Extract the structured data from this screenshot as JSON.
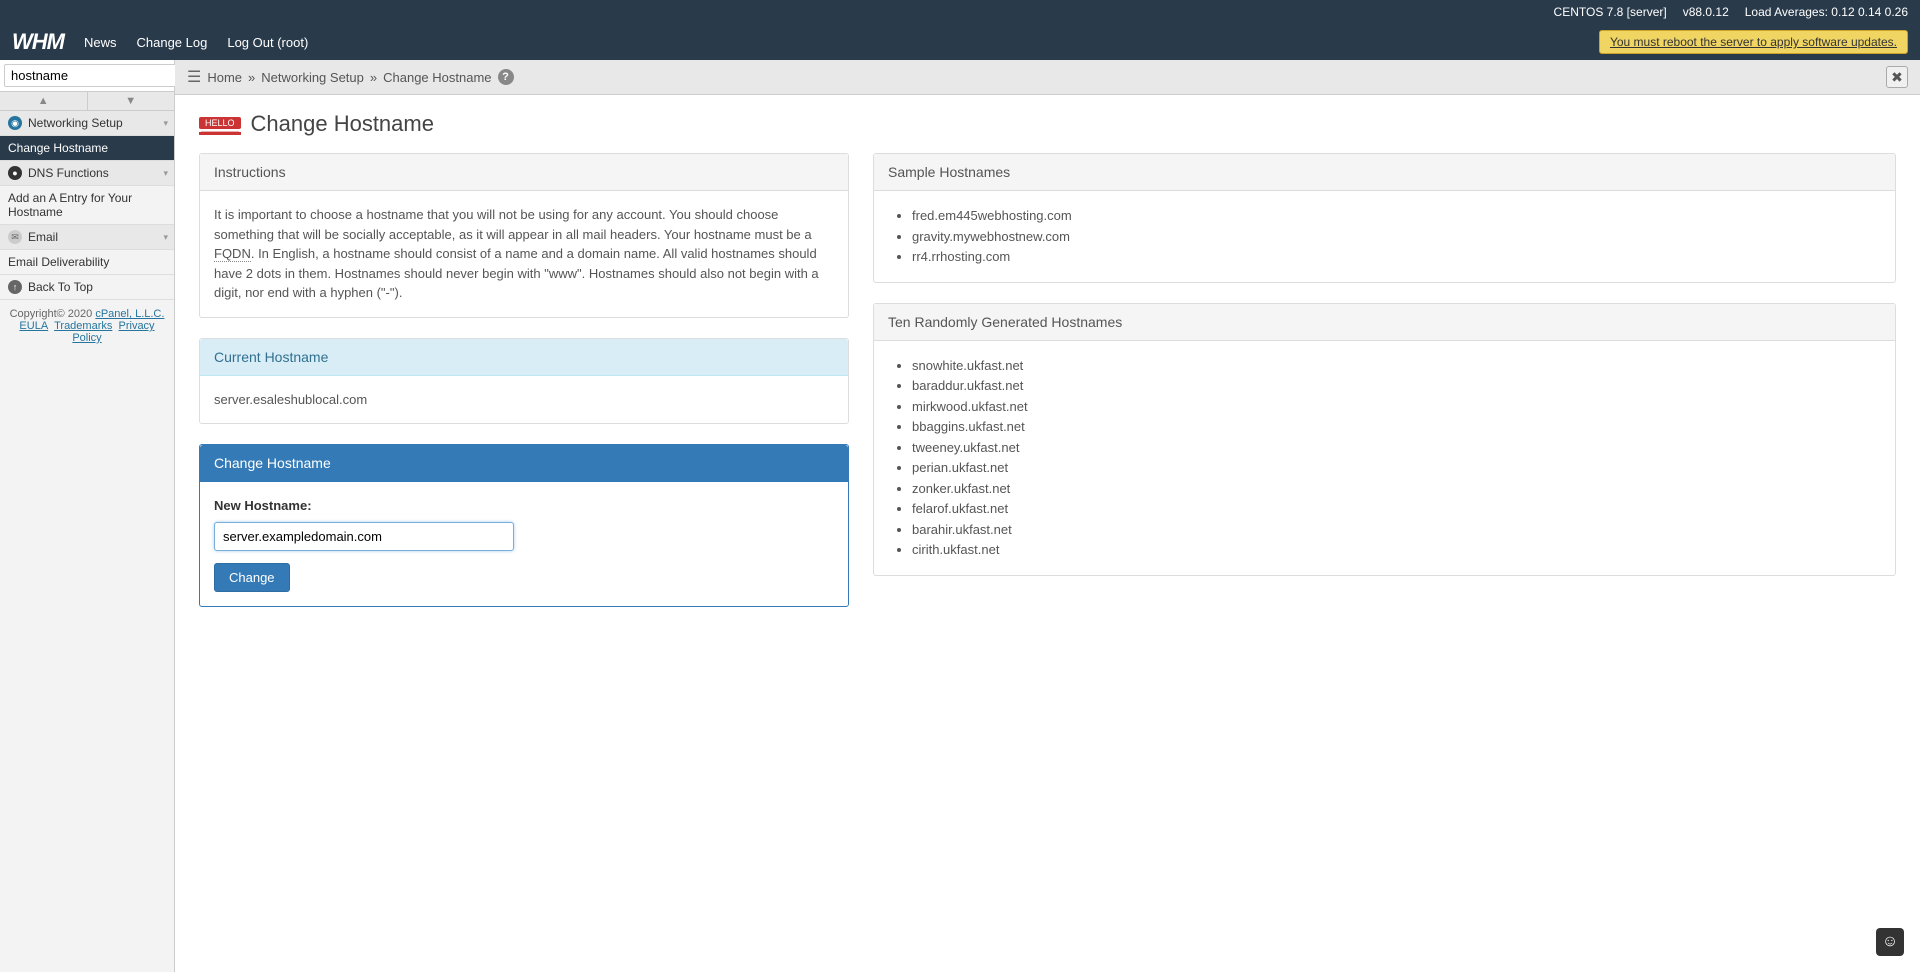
{
  "status": {
    "os": "CENTOS 7.8 [server]",
    "version": "v88.0.12",
    "load_label": "Load Averages: 0.12 0.14 0.26"
  },
  "nav": {
    "logo": "WHM",
    "news": "News",
    "changelog": "Change Log",
    "logout": "Log Out (root)",
    "reboot_notice": "You must reboot the server to apply software updates."
  },
  "search": {
    "value": "hostname"
  },
  "sidebar": {
    "items": [
      {
        "label": "Networking Setup",
        "icon": "globe",
        "section": true,
        "chev": true
      },
      {
        "label": "Change Hostname",
        "active": true
      },
      {
        "label": "DNS Functions",
        "icon": "dns",
        "section": true,
        "chev": true
      },
      {
        "label": "Add an A Entry for Your Hostname"
      },
      {
        "label": "Email",
        "icon": "mail",
        "section": true,
        "chev": true
      },
      {
        "label": "Email Deliverability"
      },
      {
        "label": "Back To Top",
        "icon": "up"
      }
    ],
    "footer": {
      "copyright": "Copyright© 2020 ",
      "cpanel": "cPanel, L.L.C.",
      "eula": "EULA",
      "trademarks": "Trademarks",
      "privacy": "Privacy Policy"
    }
  },
  "breadcrumb": {
    "home": "Home",
    "sep": "»",
    "l1": "Networking Setup",
    "l2": "Change Hostname"
  },
  "page": {
    "badge": "HELLO",
    "title": "Change Hostname"
  },
  "instructions": {
    "heading": "Instructions",
    "text_before": "It is important to choose a hostname that you will not be using for any account. You should choose something that will be socially acceptable, as it will appear in all mail headers. Your hostname must be a ",
    "fqdn": "FQDN",
    "text_after": ". In English, a hostname should consist of a name and a domain name. All valid hostnames should have 2 dots in them. Hostnames should never begin with \"www\". Hostnames should also not begin with a digit, nor end with a hyphen (\"-\")."
  },
  "current": {
    "heading": "Current Hostname",
    "value": "server.esaleshublocal.com"
  },
  "change": {
    "heading": "Change Hostname",
    "label": "New Hostname:",
    "value": "server.exampledomain.com",
    "button": "Change"
  },
  "sample": {
    "heading": "Sample Hostnames",
    "list": [
      "fred.em445webhosting.com",
      "gravity.mywebhostnew.com",
      "rr4.rrhosting.com"
    ]
  },
  "random": {
    "heading": "Ten Randomly Generated Hostnames",
    "list": [
      "snowhite.ukfast.net",
      "baraddur.ukfast.net",
      "mirkwood.ukfast.net",
      "bbaggins.ukfast.net",
      "tweeney.ukfast.net",
      "perian.ukfast.net",
      "zonker.ukfast.net",
      "felarof.ukfast.net",
      "barahir.ukfast.net",
      "cirith.ukfast.net"
    ]
  }
}
